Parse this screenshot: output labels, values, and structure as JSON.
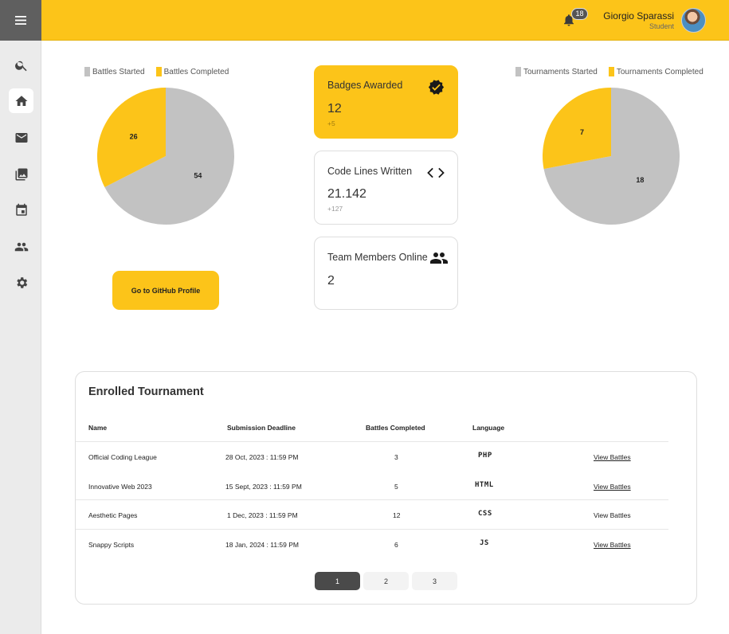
{
  "header": {
    "notification_count": "18",
    "user_name": "Giorgio Sparassi",
    "user_role": "Student"
  },
  "sidebar": {
    "items": [
      {
        "icon": "search-icon"
      },
      {
        "icon": "home-icon",
        "active": true
      },
      {
        "icon": "mail-icon"
      },
      {
        "icon": "gallery-icon"
      },
      {
        "icon": "calendar-icon"
      },
      {
        "icon": "people-icon"
      },
      {
        "icon": "gear-icon"
      }
    ]
  },
  "colors": {
    "accent": "#fcc419",
    "grey": "#c2c2c2"
  },
  "chart_data": [
    {
      "type": "pie",
      "categories": [
        "Battles Started",
        "Battles Completed"
      ],
      "values": [
        54,
        26
      ],
      "colors": [
        "#c2c2c2",
        "#fcc419"
      ],
      "legend": "top"
    },
    {
      "type": "pie",
      "categories": [
        "Tournaments Started",
        "Tournaments Completed"
      ],
      "values": [
        18,
        7
      ],
      "colors": [
        "#c2c2c2",
        "#fcc419"
      ],
      "legend": "top"
    }
  ],
  "github_button": "Go to GitHub Profile",
  "cards": [
    {
      "title": "Badges Awarded",
      "value": "12",
      "delta": "+5"
    },
    {
      "title": "Code Lines Written",
      "value": "21.142",
      "delta": "+127"
    },
    {
      "title": "Team Members Online",
      "value": "2"
    }
  ],
  "table": {
    "title": "Enrolled Tournament",
    "headers": [
      "Name",
      "Submission Deadline",
      "Battles Completed",
      "Language"
    ],
    "rows": [
      {
        "name": "Official Coding League",
        "deadline": "28 Oct, 2023 : 11:59 PM",
        "battles": "3",
        "language": "PHP",
        "action": "View Battles"
      },
      {
        "name": "Innovative Web 2023",
        "deadline": "15 Sept, 2023 : 11:59 PM",
        "battles": "5",
        "language": "HTML",
        "action": "View Battles"
      },
      {
        "name": "Aesthetic Pages",
        "deadline": "1 Dec, 2023 : 11:59 PM",
        "battles": "12",
        "language": "CSS",
        "action": "View Battles"
      },
      {
        "name": "Snappy Scripts",
        "deadline": "18 Jan, 2024 : 11:59 PM",
        "battles": "6",
        "language": "JS",
        "action": "View Battles"
      }
    ]
  },
  "pagination": {
    "pages": [
      "1",
      "2",
      "3"
    ],
    "current": "1"
  }
}
